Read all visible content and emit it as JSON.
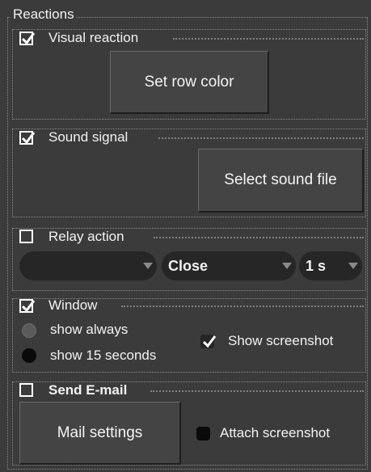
{
  "group_title": "Reactions",
  "visual": {
    "label": "Visual reaction",
    "checked": true,
    "button": "Set row color"
  },
  "sound": {
    "label": "Sound signal",
    "checked": true,
    "button": "Select sound file"
  },
  "relay": {
    "label": "Relay action",
    "checked": false,
    "combo1": "",
    "combo2": "Close",
    "combo3": "1 s"
  },
  "window": {
    "label": "Window",
    "checked": true,
    "radio1": "show always",
    "radio2": "show 15 seconds",
    "show_screenshot": "Show screenshot",
    "show_screenshot_checked": true
  },
  "email": {
    "label": "Send E-mail",
    "checked": false,
    "button": "Mail settings",
    "attach": "Attach screenshot",
    "attach_checked": false
  },
  "colors": {
    "background": "#3b3b3b",
    "combo": "#262626",
    "text": "#ffffff"
  },
  "icons": {
    "check": "check-icon",
    "dropdown": "chevron-down-icon"
  }
}
